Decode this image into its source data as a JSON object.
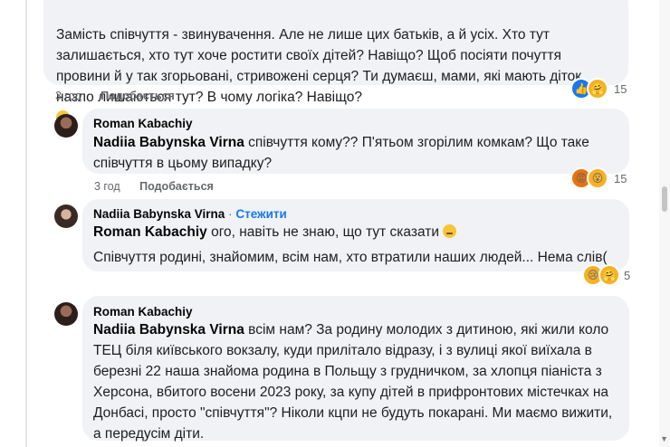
{
  "comment1": {
    "text": "Замість співчуття - звинувачення. Але не лише цих батьків, а й усіх. Хто тут залишається, хто тут хоче ростити своїх дітей? Навіщо? Щоб посіяти почуття провини й у так згорьовані, стривожені серця? Ти думаєш, мами, які мають діток, назло лишаються тут? В чому логіка? Навіщо?",
    "time": "3 год",
    "like": "Подобається",
    "reaction_count": "15",
    "reactions": [
      "like",
      "care"
    ]
  },
  "comment2": {
    "author": "Roman Kabachiy",
    "tag": "Nadiia Babynska Virna",
    "text": " співчуття кому?? П'ятьом згорілим комкам? Що таке співчуття в цьому випадку?",
    "time": "3 год",
    "like": "Подобається",
    "reaction_count": "15",
    "reactions": [
      "angry",
      "wow"
    ]
  },
  "comment3": {
    "author": "Nadiia Babynska Virna",
    "separator": "·",
    "follow": "Стежити",
    "tag": "Roman Kabachiy",
    "text_line1": " ого, навіть не знаю, що тут сказати",
    "text_line2": "Співчуття родині, знайомим, всім нам, хто втратили наших людей... Нема слів(",
    "reaction_count": "5",
    "reactions": [
      "sad",
      "care"
    ]
  },
  "comment4": {
    "author": "Roman Kabachiy",
    "tag": "Nadiia Babynska Virna",
    "text": " всім нам? За родину молодих з дитиною, які жили коло ТЕЦ біля київського вокзалу, куди прилітало відразу, і з вулиці якої виїхала в березні 22 наша знайома родина в Польщу з грудничком, за хлопця піаніста з Херсона, вбитого восени 2023 року, за купу дітей в прифронтових містечках на Донбасі, просто \"співчуття\"? Ніколи кцпи не будуть покарані. Ми маємо вижити, а передусім діти."
  },
  "icons": {
    "like": "👍",
    "care": "🤗",
    "angry": "😡",
    "wow": "😮",
    "sad": "😢"
  },
  "colors": {
    "bubble": "#f0f2f5",
    "link": "#1877f2",
    "meta": "#65676b"
  }
}
